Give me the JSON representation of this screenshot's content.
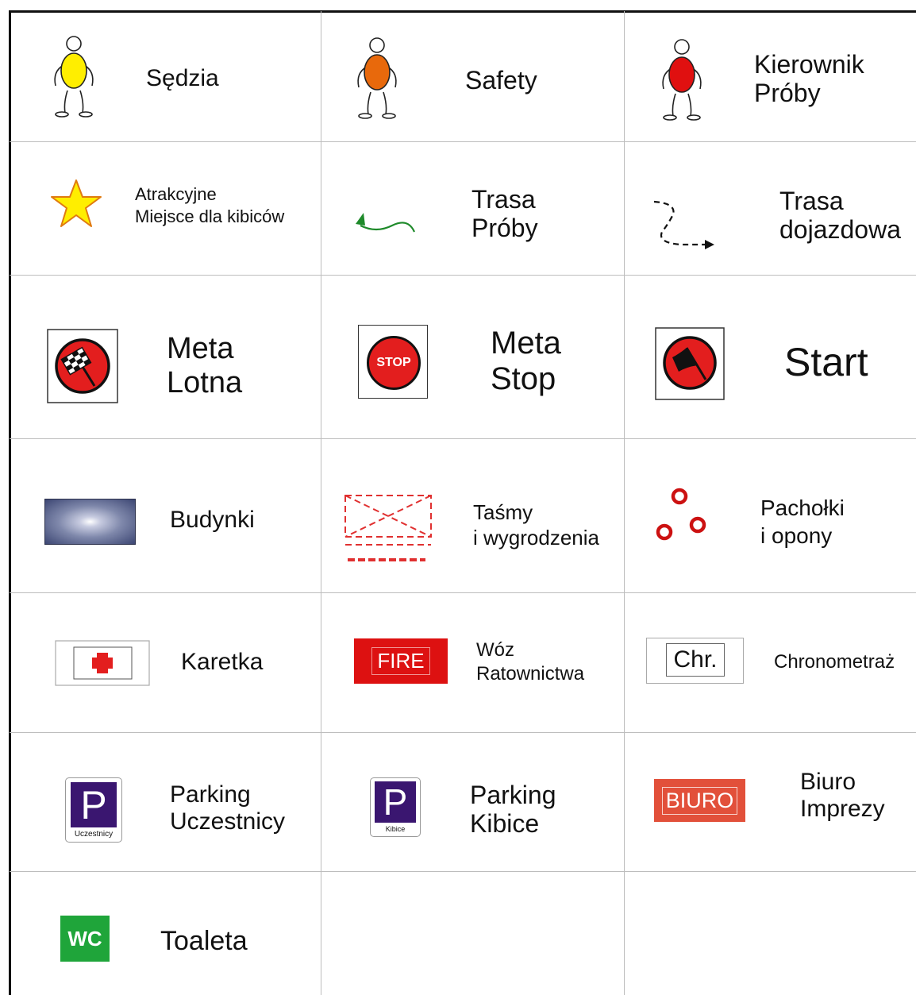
{
  "legend": {
    "colors": {
      "judge": "#ffee00",
      "safety": "#e8690c",
      "manager": "#e01010",
      "star": "#ffee00",
      "route": "#1e8a2a",
      "sign_red": "#e31e1e",
      "tape": "#e03030",
      "cones": "#cc1111",
      "fire": "#dd1111",
      "parking": "#3a1670",
      "biuro": "#e2503a",
      "wc": "#1fa53a"
    },
    "cells": [
      {
        "id": "sedzia",
        "icon": "person-yellow-icon",
        "lines": [
          "Sędzia"
        ]
      },
      {
        "id": "safety",
        "icon": "person-orange-icon",
        "lines": [
          "Safety"
        ]
      },
      {
        "id": "kierownik",
        "icon": "person-red-icon",
        "lines": [
          "Kierownik",
          "Próby"
        ]
      },
      {
        "id": "atrakcyjne",
        "icon": "star-icon",
        "lines": [
          "Atrakcyjne",
          "Miejsce dla kibiców"
        ]
      },
      {
        "id": "trasa-proby",
        "icon": "green-route-arrow-icon",
        "lines": [
          "Trasa",
          "Próby"
        ]
      },
      {
        "id": "trasa-dojazdowa",
        "icon": "dashed-route-arrow-icon",
        "lines": [
          "Trasa",
          "dojazdowa"
        ]
      },
      {
        "id": "meta-lotna",
        "icon": "checkered-flag-sign-icon",
        "lines": [
          "Meta",
          "Lotna"
        ]
      },
      {
        "id": "meta-stop",
        "icon": "stop-sign-icon",
        "sign_text": "STOP",
        "lines": [
          "Meta",
          "Stop"
        ]
      },
      {
        "id": "start",
        "icon": "start-flag-sign-icon",
        "lines": [
          "Start"
        ]
      },
      {
        "id": "budynki",
        "icon": "building-icon",
        "lines": [
          "Budynki"
        ]
      },
      {
        "id": "tasmy",
        "icon": "tape-barrier-icon",
        "lines": [
          "Taśmy",
          "i wygrodzenia"
        ]
      },
      {
        "id": "pacholki",
        "icon": "cones-icon",
        "lines": [
          "Pachołki",
          "i opony"
        ]
      },
      {
        "id": "karetka",
        "icon": "ambulance-cross-icon",
        "lines": [
          "Karetka"
        ]
      },
      {
        "id": "woz",
        "icon": "fire-sign-icon",
        "sign_text": "FIRE",
        "lines": [
          "Wóz",
          "Ratownictwa"
        ]
      },
      {
        "id": "chronometraz",
        "icon": "chrono-sign-icon",
        "sign_text": "Chr.",
        "lines": [
          "Chronometraż"
        ]
      },
      {
        "id": "parking-uczestnicy",
        "icon": "parking-participants-icon",
        "sign_text": "P",
        "sign_sub": "Uczestnicy",
        "lines": [
          "Parking",
          "Uczestnicy"
        ]
      },
      {
        "id": "parking-kibice",
        "icon": "parking-spectators-icon",
        "sign_text": "P",
        "sign_sub": "Kibice",
        "lines": [
          "Parking",
          "Kibice"
        ]
      },
      {
        "id": "biuro",
        "icon": "biuro-sign-icon",
        "sign_text": "BIURO",
        "lines": [
          "Biuro",
          "Imprezy"
        ]
      },
      {
        "id": "toaleta",
        "icon": "wc-sign-icon",
        "sign_text": "WC",
        "lines": [
          "Toaleta"
        ]
      }
    ]
  }
}
